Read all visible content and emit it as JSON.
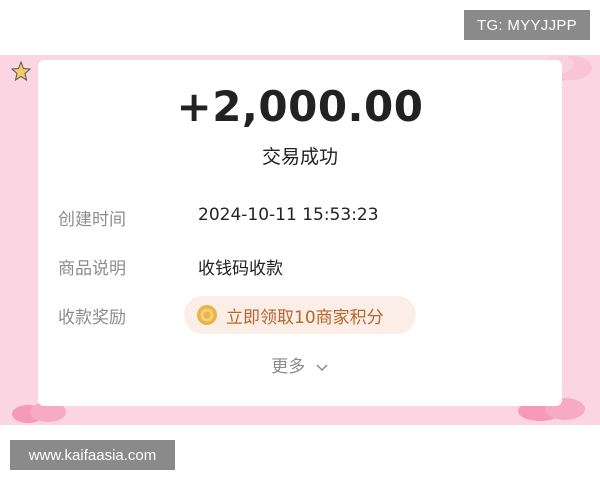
{
  "watermarks": {
    "top": "TG: MYYJJPP",
    "bottom": "www.kaifaasia.com"
  },
  "transaction": {
    "amount": "+2,000.00",
    "status": "交易成功"
  },
  "details": [
    {
      "label": "创建时间",
      "value": "2024-10-11 15:53:23"
    },
    {
      "label": "商品说明",
      "value": "收钱码收款"
    },
    {
      "label": "收款奖励",
      "value": "立即领取10商家积分"
    }
  ],
  "more_label": "更多",
  "colors": {
    "background_band": "#fbd5e2",
    "card": "#ffffff",
    "reward_pill": "#fbeee6",
    "reward_text": "#b7652c",
    "label_gray": "#8c8c8c",
    "text_dark": "#222222",
    "watermark": "#8a8a8a"
  },
  "icons": {
    "reward": "gold-coin-icon",
    "more": "chevron-down-icon"
  }
}
